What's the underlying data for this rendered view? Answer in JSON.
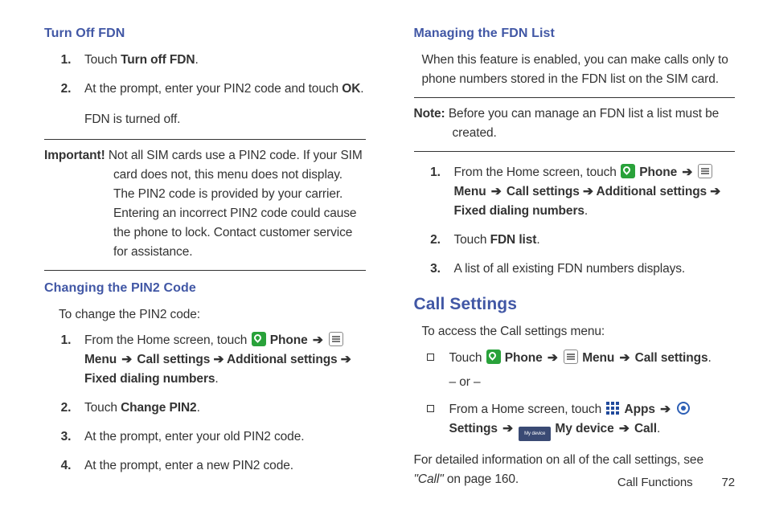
{
  "left": {
    "h_turnoff": "Turn Off FDN",
    "turnoff_steps": {
      "s1_pre": "Touch ",
      "s1_b": "Turn off FDN",
      "s1_post": ".",
      "s2_pre": "At the prompt, enter your PIN2 code and touch ",
      "s2_b": "OK",
      "s2_post": ".",
      "s2_result": "FDN is turned off."
    },
    "important_label": "Important! ",
    "important_text": "Not all SIM cards use a PIN2 code. If your SIM card does not, this menu does not display. The PIN2 code is provided by your carrier. Entering an incorrect PIN2 code could cause the phone to lock. Contact customer service for assistance.",
    "h_change": "Changing the PIN2 Code",
    "change_intro": "To change the PIN2 code:",
    "change_steps": {
      "s1_pre": "From the Home screen, touch ",
      "phone": "Phone",
      "arrow": "➔",
      "menu": "Menu",
      "path_rest": " Call settings ➔ Additional settings ➔ Fixed dialing numbers",
      "s1_post": ".",
      "s2_pre": "Touch ",
      "s2_b": "Change PIN2",
      "s2_post": ".",
      "s3": "At the prompt, enter your old PIN2 code.",
      "s4": "At the prompt, enter a new PIN2 code."
    }
  },
  "right": {
    "h_manage": "Managing the FDN List",
    "manage_intro": "When this feature is enabled, you can make calls only to phone numbers stored in the FDN list on the SIM card.",
    "note_label": "Note: ",
    "note_text": "Before you can manage an FDN list a list must be created.",
    "manage_steps": {
      "s1_pre": "From the Home screen, touch ",
      "phone": "Phone",
      "arrow": "➔",
      "menu": "Menu",
      "path_rest": " Call settings ➔ Additional settings ➔ Fixed dialing numbers",
      "s1_post": ".",
      "s2_pre": "Touch ",
      "s2_b": "FDN list",
      "s2_post": ".",
      "s3": "A list of all existing FDN numbers displays."
    },
    "h_callsettings": "Call Settings",
    "cs_intro": "To access the Call settings menu:",
    "cs_b1_pre": "Touch ",
    "cs_phone": "Phone",
    "cs_arrow": "➔",
    "cs_menu": "Menu",
    "cs_b1_mid": " Call settings",
    "cs_b1_post": ".",
    "cs_or": "– or –",
    "cs_b2_pre": "From a Home screen, touch ",
    "cs_apps": "Apps",
    "cs_settings": "Settings",
    "cs_mydevice": "My device",
    "cs_call": "Call",
    "cs_b2_post": ".",
    "cs_after_pre": "For detailed information on all of the call settings, see ",
    "cs_after_ref": "\"Call\"",
    "cs_after_post": " on page 160."
  },
  "footer": {
    "section": "Call Functions",
    "page": "72"
  }
}
